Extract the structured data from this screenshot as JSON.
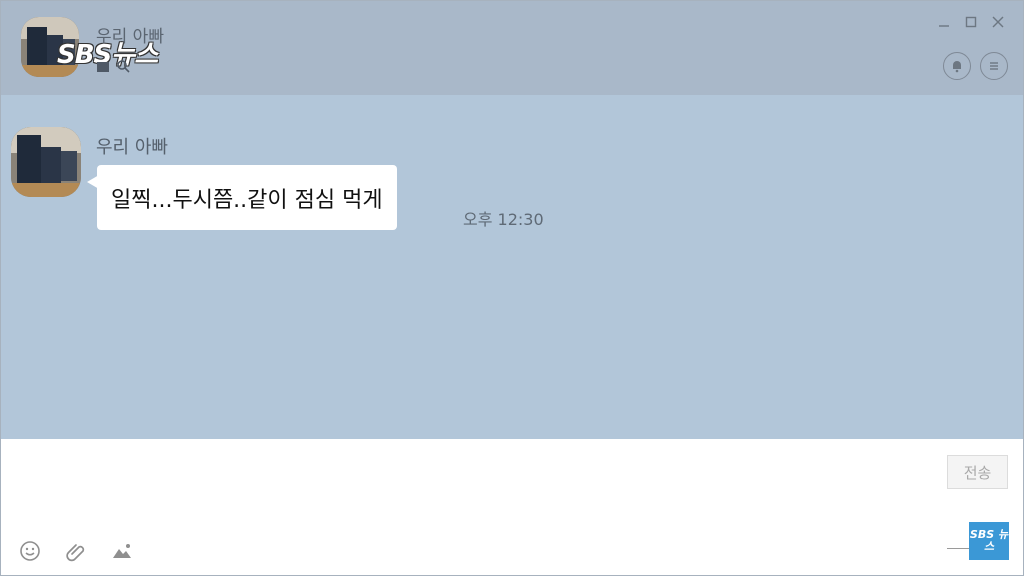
{
  "header": {
    "chat_title": "우리 아빠",
    "logo_text": "SBS뉴스",
    "window_controls": [
      "minimize-icon",
      "maximize-icon",
      "close-icon"
    ],
    "actions": [
      "bell-icon",
      "menu-icon"
    ]
  },
  "messages": [
    {
      "sender": "우리 아빠",
      "text": "일찍...두시쯤..같이 점심 먹게",
      "time": "오후 12:30"
    }
  ],
  "input": {
    "send_label": "전송",
    "tools": [
      "emoji-icon",
      "attachment-icon",
      "image-icon"
    ]
  },
  "watermark": {
    "text": "SBS 뉴스"
  },
  "colors": {
    "header_bg": "#a9b8c9",
    "chat_bg": "#b2c6d9",
    "bubble_bg": "#ffffff",
    "watermark_bg": "#3b98d6"
  }
}
